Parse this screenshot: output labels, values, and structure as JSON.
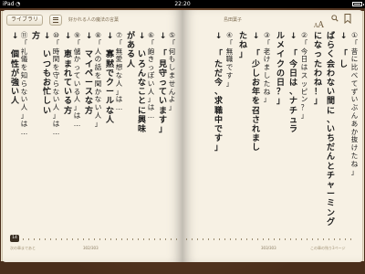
{
  "status": {
    "carrier": "iPad",
    "time": "22:20"
  },
  "toolbar": {
    "library_label": "ライブラリ",
    "book_title": "好かれる人の魔法の言葉",
    "author": "島田葉子",
    "font_small": "A",
    "font_large": "A"
  },
  "icons": {
    "toc": "toc-list-icon",
    "search": "search-icon",
    "bookmark": "bookmark-icon",
    "wifi": "wifi-icon",
    "battery": "battery-icon"
  },
  "left_page": {
    "columns": [
      {
        "text": "⑤「何もしませんよ」",
        "bold": false
      },
      {
        "text": "↓ 「見守っています」",
        "bold": true
      },
      {
        "text": "⑥「飽きっぽい人」は…",
        "bold": false
      },
      {
        "text": "↓ いろんなことに興味",
        "bold": true
      },
      {
        "text": "がある人",
        "bold": true
      },
      {
        "text": "⑦「無愛想な人」は…",
        "bold": false
      },
      {
        "text": "↓ 寡黙でクールな人",
        "bold": true
      },
      {
        "text": "⑧「人の話を聞かない人」",
        "bold": false
      },
      {
        "text": "↓ マイペースな方",
        "bold": true
      },
      {
        "text": "⑨「儲かっている人」は…",
        "bold": false
      },
      {
        "text": "↓ 恵まれている方",
        "bold": true
      },
      {
        "text": "⑩「時間を守らない人」は…",
        "bold": false
      },
      {
        "text": "↓ いつもお忙しい",
        "bold": true
      },
      {
        "text": "方",
        "bold": true
      },
      {
        "text": "⑪「礼儀を知らない人」は…",
        "bold": false
      },
      {
        "text": "↓ 個性が強い人",
        "bold": true
      }
    ],
    "page_number": "302/303"
  },
  "right_page": {
    "columns": [
      {
        "text": "①「昔に比べてずいぶんあか抜けたね」",
        "bold": false
      },
      {
        "text": "↓ 「し",
        "bold": true
      },
      {
        "text": "ばらく会わない間に、いちだんとチャーミング",
        "bold": true
      },
      {
        "text": "になったわね！」",
        "bold": true
      },
      {
        "text": "②「今日はスッピン？」",
        "bold": false
      },
      {
        "text": "↓ 「今日は、ナチュラ",
        "bold": true
      },
      {
        "text": "ルメイクの日？」",
        "bold": true
      },
      {
        "text": "③「老けましたね」",
        "bold": false
      },
      {
        "text": "↓ 「少しお年を召されまし",
        "bold": true
      },
      {
        "text": "たね」",
        "bold": true
      },
      {
        "text": "④「無職です」",
        "bold": false
      },
      {
        "text": "↓ 「ただ今、求職中です」",
        "bold": true
      }
    ],
    "page_number": "303/303"
  },
  "slider": {
    "current_page": "14",
    "left_remaining": "次の章まであと",
    "right_remaining": "この章の残り3ページ"
  }
}
